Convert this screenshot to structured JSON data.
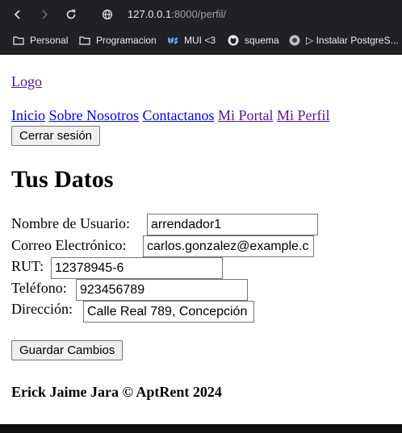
{
  "browser": {
    "url_host": "127.0.0.1",
    "url_path": ":8000/perfil/",
    "bookmarks": [
      {
        "label": "Personal",
        "icon": "folder-icon"
      },
      {
        "label": "Programacion",
        "icon": "folder-icon"
      },
      {
        "label": "MUI <3",
        "icon": "mui-icon"
      },
      {
        "label": "squema",
        "icon": "github-icon"
      },
      {
        "label": "▷ Instalar PostgreS...",
        "icon": "globe-icon"
      }
    ]
  },
  "nav": {
    "logo": "Logo",
    "links": [
      "Inicio",
      "Sobre Nosotros",
      "Contactanos",
      "Mi Portal",
      "Mi Perfil"
    ],
    "logout": "Cerrar sesión"
  },
  "form": {
    "title": "Tus Datos",
    "fields": [
      {
        "label": "Nombre de Usuario:",
        "value": "arrendador1"
      },
      {
        "label": "Correo Electrónico:",
        "value": "carlos.gonzalez@example.c"
      },
      {
        "label": "RUT:",
        "value": "12378945-6"
      },
      {
        "label": "Teléfono:",
        "value": "923456789"
      },
      {
        "label": "Dirección:",
        "value": "Calle Real 789, Concepción"
      }
    ],
    "save": "Guardar Cambios"
  },
  "footer": {
    "text": "Erick Jaime Jara © AptRent 2024"
  }
}
